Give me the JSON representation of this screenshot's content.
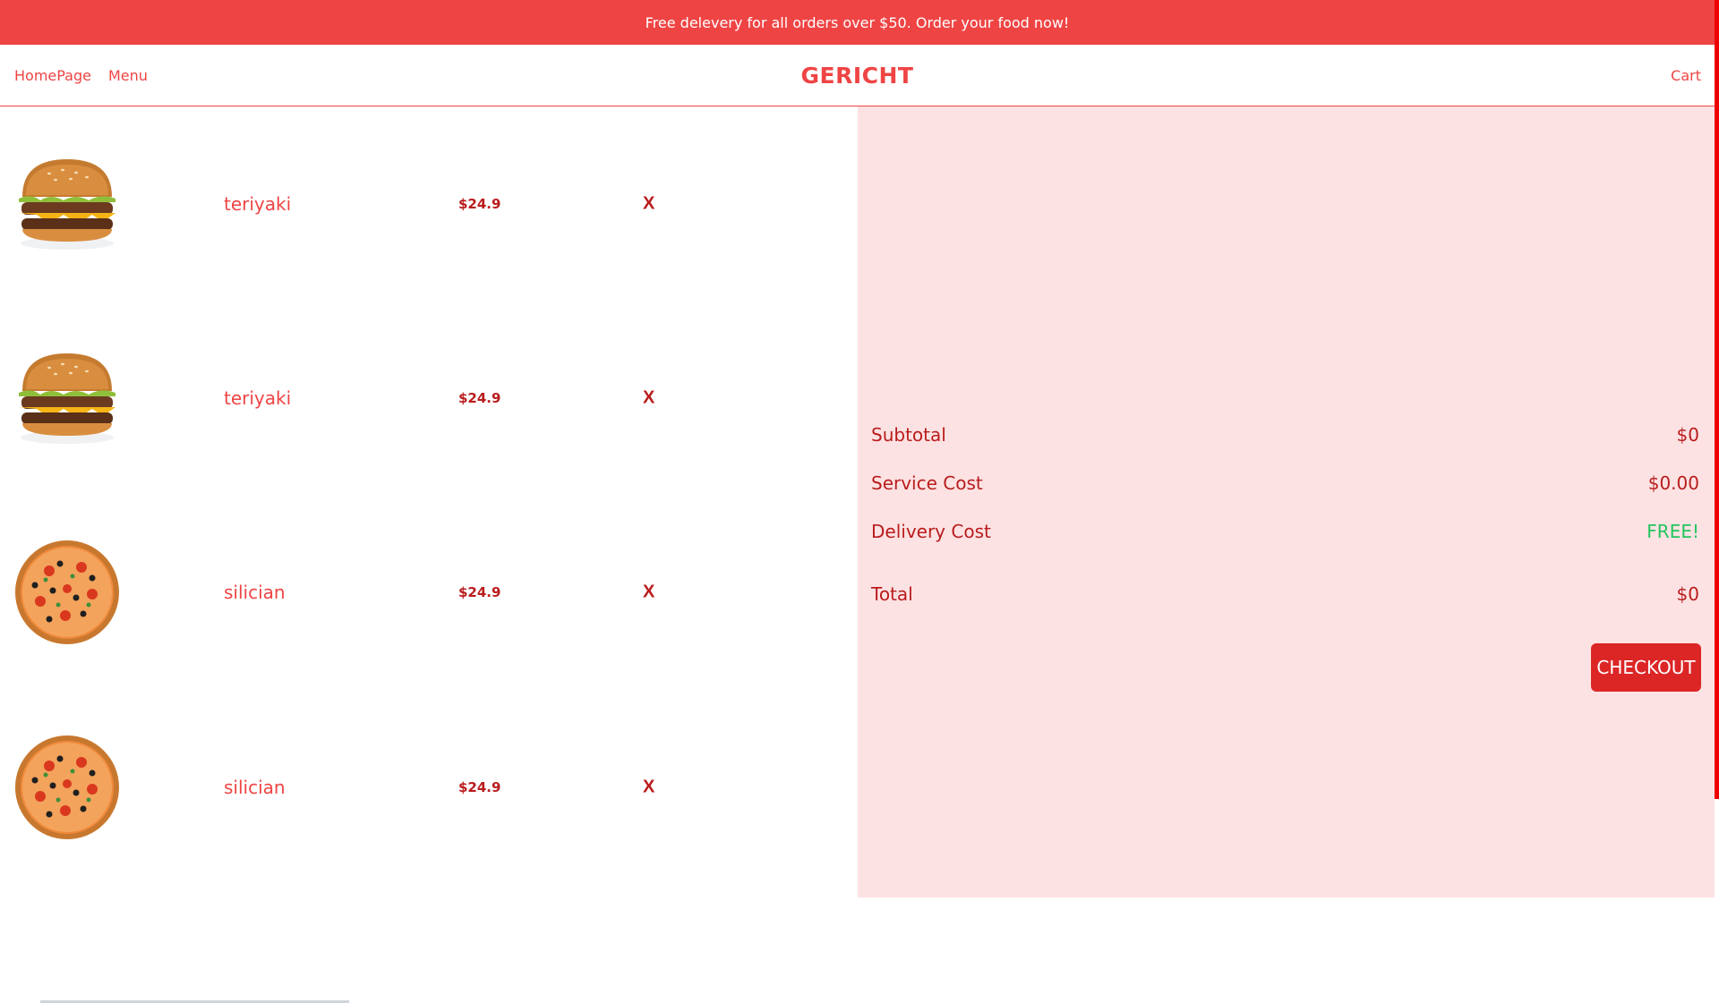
{
  "banner": {
    "text": "Free delevery for all orders over $50. Order your food now!"
  },
  "nav": {
    "links": [
      "HomePage",
      "Menu"
    ],
    "brand": "GERICHT",
    "cart": "Cart"
  },
  "cart_items": [
    {
      "name": "teriyaki",
      "price": "$24.9",
      "remove": "X",
      "image": "burger"
    },
    {
      "name": "teriyaki",
      "price": "$24.9",
      "remove": "X",
      "image": "burger"
    },
    {
      "name": "silician",
      "price": "$24.9",
      "remove": "X",
      "image": "pizza"
    },
    {
      "name": "silician",
      "price": "$24.9",
      "remove": "X",
      "image": "pizza"
    }
  ],
  "summary": {
    "subtotal_label": "Subtotal",
    "subtotal_value": "$0",
    "service_label": "Service Cost",
    "service_value": "$0.00",
    "delivery_label": "Delivery Cost",
    "delivery_value": "FREE!",
    "total_label": "Total",
    "total_value": "$0",
    "checkout_label": "CHECKOUT"
  },
  "colors": {
    "accent": "#ef4444",
    "dark_red": "#b91c1c",
    "panel_bg": "#fde2e3",
    "free_green": "#22c55e"
  }
}
